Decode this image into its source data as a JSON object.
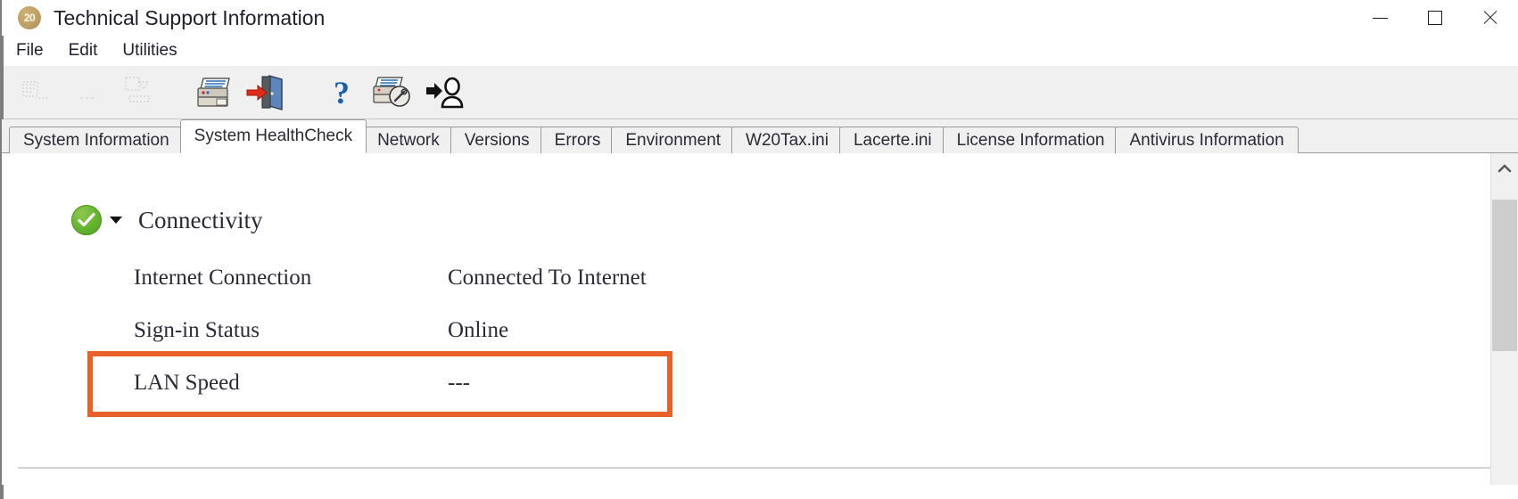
{
  "window": {
    "title": "Technical Support Information",
    "icon_badge": "20",
    "icon_name": "lacerte-20-icon",
    "controls": [
      {
        "name": "minimize-button",
        "label": "Minimize"
      },
      {
        "name": "maximize-button",
        "label": "Maximize"
      },
      {
        "name": "close-button",
        "label": "Close"
      }
    ]
  },
  "menubar": {
    "items": [
      {
        "label": "File"
      },
      {
        "label": "Edit"
      },
      {
        "label": "Utilities"
      }
    ]
  },
  "toolbar": {
    "buttons": [
      {
        "name": "print-setup-disabled-icon",
        "label": "Print Setup",
        "enabled": false
      },
      {
        "name": "page-setup-disabled-icon",
        "label": "Page Setup",
        "enabled": false
      },
      {
        "name": "export-disabled-icon",
        "label": "Export",
        "enabled": false
      },
      {
        "name": "print-icon",
        "label": "Print",
        "enabled": true
      },
      {
        "name": "exit-door-icon",
        "label": "Exit",
        "enabled": true
      },
      {
        "name": "help-question-icon",
        "label": "Help",
        "enabled": true
      },
      {
        "name": "print-preview-icon",
        "label": "Print Preview",
        "enabled": true
      },
      {
        "name": "add-user-icon",
        "label": "Add User",
        "enabled": true
      }
    ]
  },
  "tabs": {
    "active_index": 1,
    "items": [
      {
        "label": "System Information"
      },
      {
        "label": "System HealthCheck"
      },
      {
        "label": "Network"
      },
      {
        "label": "Versions"
      },
      {
        "label": "Errors"
      },
      {
        "label": "Environment"
      },
      {
        "label": "W20Tax.ini"
      },
      {
        "label": "Lacerte.ini"
      },
      {
        "label": "License Information"
      },
      {
        "label": "Antivirus Information"
      }
    ]
  },
  "content": {
    "group": {
      "title": "Connectivity",
      "status": "ok",
      "status_color": "#63b32e",
      "expanded": true
    },
    "rows": [
      {
        "label": "Internet Connection",
        "value": "Connected To Internet",
        "highlighted": false
      },
      {
        "label": "Sign-in Status",
        "value": "Online",
        "highlighted": false
      },
      {
        "label": "LAN Speed",
        "value": "---",
        "highlighted": true
      }
    ]
  },
  "highlight": {
    "color": "#E8612A",
    "target": "LAN Speed"
  },
  "scrollbar": {
    "up_arrow": "scroll-up-icon",
    "position": "top"
  }
}
